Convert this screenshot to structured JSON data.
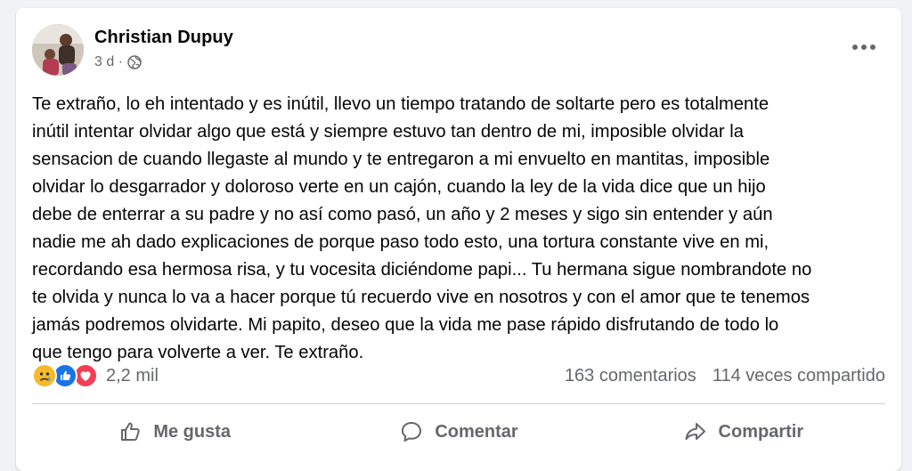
{
  "post": {
    "author": "Christian Dupuy",
    "time": "3 d ·",
    "privacy_icon": "globe-icon",
    "lines": [
      "Te extraño, lo eh intentado y es inútil, llevo un tiempo tratando de soltarte pero es totalmente",
      "inútil intentar olvidar algo que está y siempre estuvo tan dentro de mi, imposible olvidar la",
      "sensacion de cuando llegaste al mundo y te entregaron a mi envuelto en mantitas, imposible",
      "olvidar lo desgarrador y doloroso verte en un cajón, cuando la ley de la vida dice que un hijo",
      "debe de enterrar a su padre y no así como pasó, un año  y 2 meses y sigo sin entender y aún",
      "nadie me ah dado explicaciones de porque paso todo esto, una tortura constante vive en mi,",
      "recordando esa hermosa risa, y tu vocesita diciéndome papi... Tu hermana sigue nombrandote no",
      "te olvida y nunca lo va a hacer porque tú recuerdo vive en nosotros y con el amor que te tenemos",
      "jamás podremos olvidarte. Mi papito, deseo que la vida me pase rápido disfrutando de todo lo",
      "que tengo para volverte a ver. Te extraño."
    ]
  },
  "stats": {
    "reactions": [
      "sad-reaction-icon",
      "like-reaction-icon",
      "love-reaction-icon"
    ],
    "reaction_count": "2,2 mil",
    "comments": "163 comentarios",
    "shares": "114 veces compartido"
  },
  "actions": {
    "like_label": "Me gusta",
    "comment_label": "Comentar",
    "share_label": "Compartir"
  },
  "colors": {
    "secondary_text": "#65676b",
    "like_blue": "#1b74e4",
    "love_red": "#f33e58",
    "sad_yellow": "#f7b928"
  }
}
